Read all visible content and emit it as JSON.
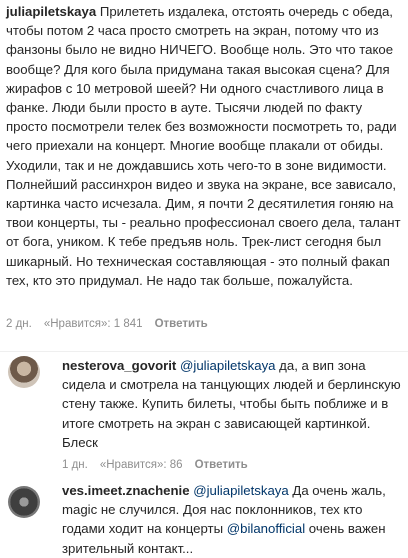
{
  "main": {
    "username": "juliapiletskaya",
    "text": "Прилететь издалека, отстоять очередь с обеда, чтобы потом 2 часа просто смотреть на экран, потому что из фанзоны было не видно НИЧЕГО. Вообще ноль. Это что такое вообще? Для кого была придумана такая высокая сцена? Для жирафов с 10 метровой шеей? Ни одного счастливого лица в фанке. Люди были просто в ауте. Тысячи людей по факту просто посмотрели телек без возможности посмотреть то, ради чего приехали на концерт. Многие вообще плакали от обиды. Уходили, так и не дождавшись хоть чего-то в зоне видимости. Полнейший рассинхрон видео и звука на экране, все зависало, картинка часто исчезала. Дим, я почти 2 десятилетия гоняю на твои концерты, ты - реально профессионал своего дела, талант от бога, уником. К тебе предъяв ноль. Трек-лист сегодня был шикарный. Но техническая составляющая - это полный факап тех, кто это придумал. Не надо так больше, пожалуйста.",
    "time": "2 дн.",
    "likes": "«Нравится»: 1 841",
    "reply": "Ответить"
  },
  "reply1": {
    "username": "nesterova_govorit",
    "mention": "@juliapiletskaya",
    "text": " да, а вип зона сидела и смотрела на танцующих людей и берлинскую стену также. Купить билеты, чтобы быть поближе и в итоге смотреть на экран с зависающей картинкой. Блеск",
    "time": "1 дн.",
    "likes": "«Нравится»: 86",
    "reply": "Ответить"
  },
  "reply2": {
    "username": "ves.imeet.znachenie",
    "mention": "@juliapiletskaya",
    "text_a": " Да очень жаль, magic не случился. Доя нас поклонников, тех кто годами ходит на концерты ",
    "mention2": "@bilanofficial",
    "text_b": " очень важен зрительный контакт..."
  }
}
